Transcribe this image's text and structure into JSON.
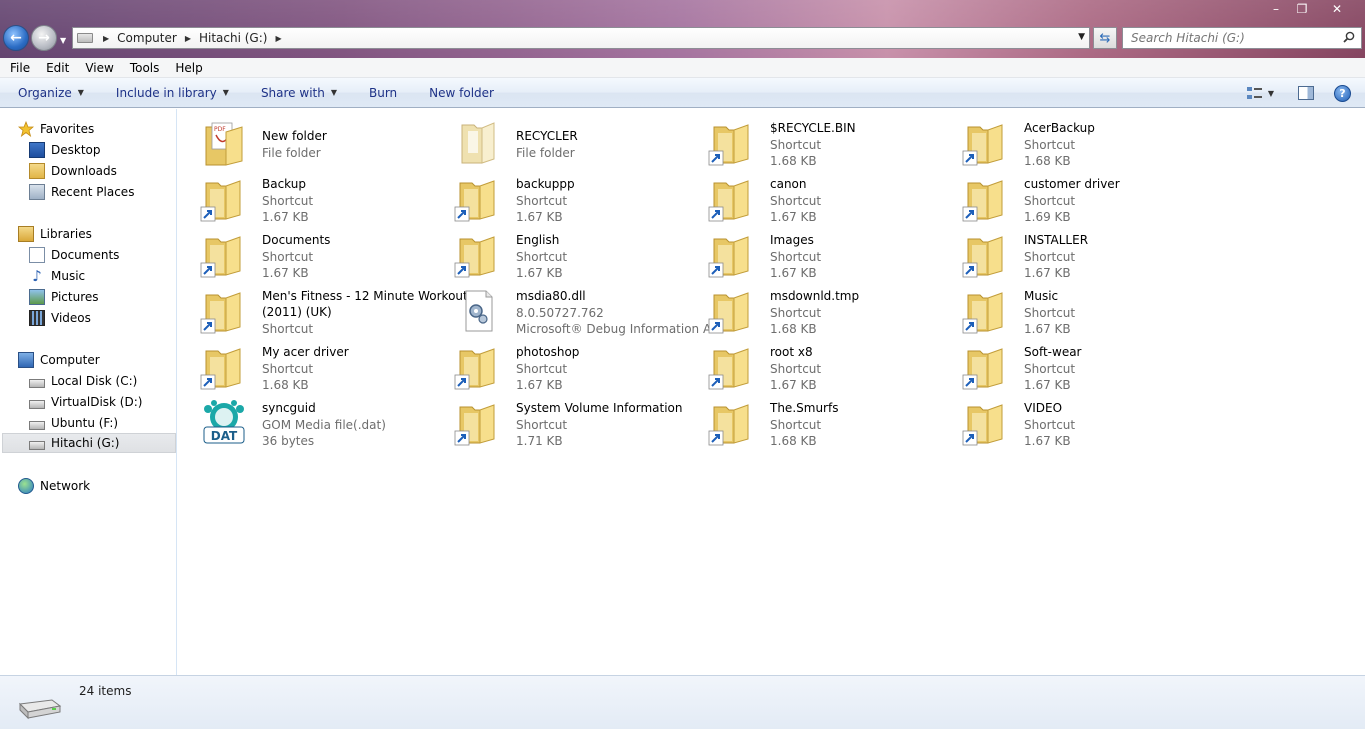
{
  "window": {
    "controls": [
      "–",
      "❐",
      "✕"
    ]
  },
  "address_bar": {
    "segments": [
      "Computer",
      "Hitachi (G:)"
    ],
    "search_placeholder": "Search Hitachi (G:)"
  },
  "menu": [
    "File",
    "Edit",
    "View",
    "Tools",
    "Help"
  ],
  "commands": [
    {
      "label": "Organize",
      "dropdown": true
    },
    {
      "label": "Include in library",
      "dropdown": true
    },
    {
      "label": "Share with",
      "dropdown": true
    },
    {
      "label": "Burn",
      "dropdown": false
    },
    {
      "label": "New folder",
      "dropdown": false
    }
  ],
  "nav": {
    "favorites": {
      "label": "Favorites",
      "items": [
        "Desktop",
        "Downloads",
        "Recent Places"
      ]
    },
    "libraries": {
      "label": "Libraries",
      "items": [
        "Documents",
        "Music",
        "Pictures",
        "Videos"
      ]
    },
    "computer": {
      "label": "Computer",
      "items": [
        "Local Disk (C:)",
        "VirtualDisk (D:)",
        "Ubuntu (F:)",
        "Hitachi (G:)"
      ]
    },
    "network": {
      "label": "Network"
    },
    "selected": "Hitachi (G:)"
  },
  "files": [
    {
      "name": "New folder",
      "type": "File folder",
      "size": "",
      "icon": "folder-pdf-icon"
    },
    {
      "name": "RECYCLER",
      "type": "File folder",
      "size": "",
      "icon": "folder-open-icon"
    },
    {
      "name": "$RECYCLE.BIN",
      "type": "Shortcut",
      "size": "1.68 KB",
      "icon": "folder-shortcut-icon"
    },
    {
      "name": "AcerBackup",
      "type": "Shortcut",
      "size": "1.68 KB",
      "icon": "folder-shortcut-icon"
    },
    {
      "name": "Backup",
      "type": "Shortcut",
      "size": "1.67 KB",
      "icon": "folder-shortcut-icon"
    },
    {
      "name": "backuppp",
      "type": "Shortcut",
      "size": "1.67 KB",
      "icon": "folder-shortcut-icon"
    },
    {
      "name": "canon",
      "type": "Shortcut",
      "size": "1.67 KB",
      "icon": "folder-shortcut-icon"
    },
    {
      "name": "customer driver",
      "type": "Shortcut",
      "size": "1.69 KB",
      "icon": "folder-shortcut-icon"
    },
    {
      "name": "Documents",
      "type": "Shortcut",
      "size": "1.67 KB",
      "icon": "folder-shortcut-icon"
    },
    {
      "name": "English",
      "type": "Shortcut",
      "size": "1.67 KB",
      "icon": "folder-shortcut-icon"
    },
    {
      "name": "Images",
      "type": "Shortcut",
      "size": "1.67 KB",
      "icon": "folder-shortcut-icon"
    },
    {
      "name": "INSTALLER",
      "type": "Shortcut",
      "size": "1.67 KB",
      "icon": "folder-shortcut-icon"
    },
    {
      "name": "Men's Fitness - 12 Minute Workout",
      "name2": "(2011) (UK)",
      "type": "Shortcut",
      "size": "",
      "icon": "folder-shortcut-icon"
    },
    {
      "name": "msdia80.dll",
      "type": "8.0.50727.762",
      "size": "Microsoft® Debug Information A...",
      "icon": "dll-gear-icon"
    },
    {
      "name": "msdownld.tmp",
      "type": "Shortcut",
      "size": "1.68 KB",
      "icon": "folder-shortcut-icon"
    },
    {
      "name": "Music",
      "type": "Shortcut",
      "size": "1.67 KB",
      "icon": "folder-shortcut-icon"
    },
    {
      "name": "My acer driver",
      "type": "Shortcut",
      "size": "1.68 KB",
      "icon": "folder-shortcut-icon"
    },
    {
      "name": "photoshop",
      "type": "Shortcut",
      "size": "1.67 KB",
      "icon": "folder-shortcut-icon"
    },
    {
      "name": "root x8",
      "type": "Shortcut",
      "size": "1.67 KB",
      "icon": "folder-shortcut-icon"
    },
    {
      "name": "Soft-wear",
      "type": "Shortcut",
      "size": "1.67 KB",
      "icon": "folder-shortcut-icon"
    },
    {
      "name": "syncguid",
      "type": "GOM Media file(.dat)",
      "size": "36 bytes",
      "icon": "dat-file-icon",
      "badge": "DAT"
    },
    {
      "name": "System Volume Information",
      "type": "Shortcut",
      "size": "1.71 KB",
      "icon": "folder-shortcut-icon"
    },
    {
      "name": "The.Smurfs",
      "type": "Shortcut",
      "size": "1.68 KB",
      "icon": "folder-shortcut-icon"
    },
    {
      "name": "VIDEO",
      "type": "Shortcut",
      "size": "1.67 KB",
      "icon": "folder-shortcut-icon"
    }
  ],
  "status": {
    "count": "24 items"
  }
}
